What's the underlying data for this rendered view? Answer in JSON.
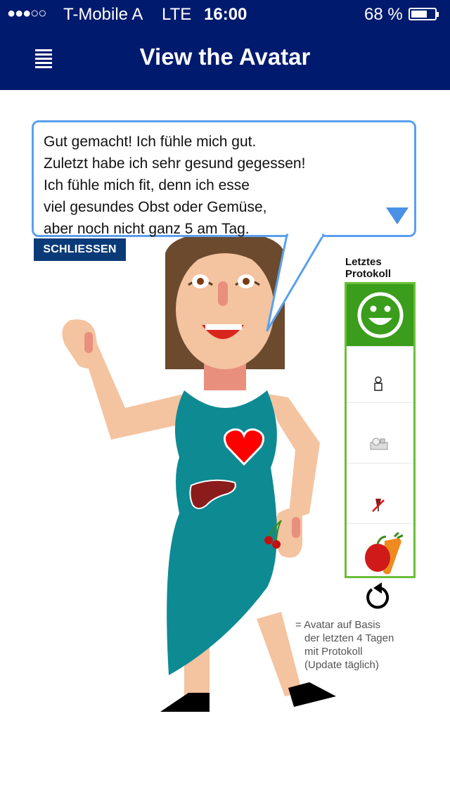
{
  "status_bar": {
    "signal_dots": "●●●○○",
    "carrier": "T-Mobile A",
    "network": "LTE",
    "time": "16:00",
    "battery_percent": "68 %",
    "battery_level": 0.68
  },
  "nav": {
    "menu_icon": "menu-icon",
    "title": "View the Avatar"
  },
  "speech_bubble": {
    "lines": [
      "Gut gemacht! Ich fühle mich gut.",
      "Zuletzt habe ich sehr gesund gegessen!",
      "Ich fühle mich fit, denn ich esse",
      "viel gesundes Obst oder Gemüse,",
      "aber noch nicht ganz 5 am Tag."
    ],
    "more_icon": "triangle-down-icon"
  },
  "close_button": "SCHLIESSEN",
  "protocol": {
    "label_line1": "Letztes",
    "label_line2": "Protokoll",
    "mood_icon": "happy-smiley-icon",
    "rows": [
      {
        "icon": "person-icon"
      },
      {
        "icon": "food-tray-icon"
      },
      {
        "icon": "no-drink-icon"
      },
      {
        "icon": "fruit-vegetable-icon"
      }
    ]
  },
  "refresh_icon": "refresh-icon",
  "note": {
    "lines": [
      "= Avatar auf Basis",
      "der letzten 4 Tagen",
      "mit Protokoll",
      "(Update täglich)"
    ]
  },
  "colors": {
    "header": "#001a6e",
    "accent_blue": "#5aa0ee",
    "green": "#3a9d1b",
    "dress": "#0e8a93",
    "skin": "#f4c3a0",
    "hair": "#6b4a2e"
  }
}
